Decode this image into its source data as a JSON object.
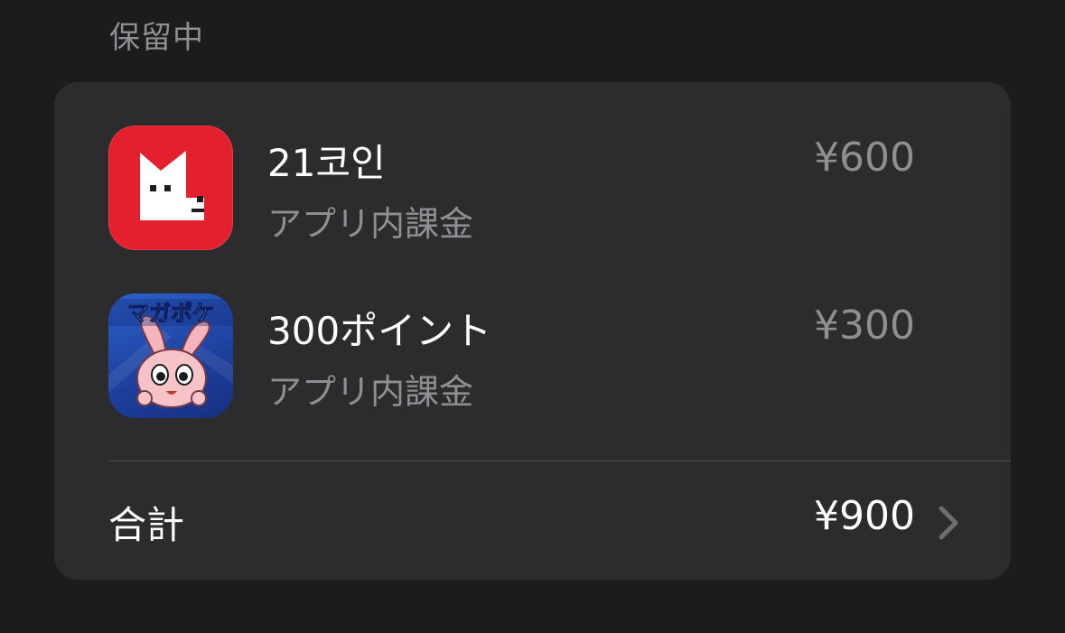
{
  "section": {
    "header": "保留中"
  },
  "items": [
    {
      "title": "21코인",
      "subtitle": "アプリ内課金",
      "price": "¥600",
      "icon": "red-fox-app-icon",
      "icon_color": "#e5202e"
    },
    {
      "title": "300ポイント",
      "subtitle": "アプリ内課金",
      "price": "¥300",
      "icon": "magapoke-app-icon",
      "icon_color": "#2c62c9",
      "icon_text": "マガポケ"
    }
  ],
  "total": {
    "label": "合計",
    "value": "¥900",
    "icon": "chevron-right-icon"
  },
  "colors": {
    "background": "#1c1c1e",
    "card": "#2c2c2e",
    "primary_text": "#ffffff",
    "secondary_text": "#8e8e93"
  }
}
